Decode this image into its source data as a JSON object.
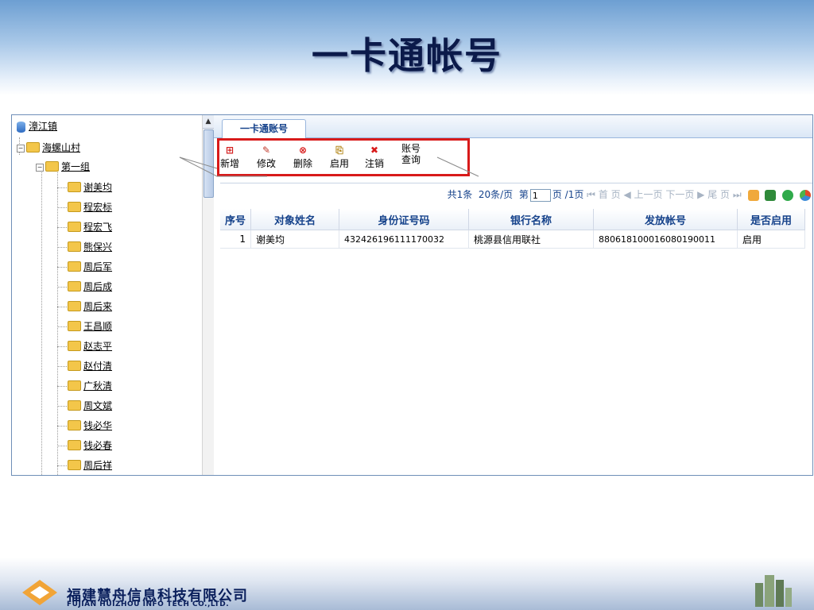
{
  "slide": {
    "title": "一卡通帐号"
  },
  "tree": {
    "root": "漳江镇",
    "village": "海螺山村",
    "group": "第一组",
    "people": [
      "谢美均",
      "程宏标",
      "程宏飞",
      "熊保兴",
      "周后军",
      "周后成",
      "周后来",
      "王昌顺",
      "赵志平",
      "赵付清",
      "广秋清",
      "周文斌",
      "钱必华",
      "钱必春",
      "周后祥"
    ]
  },
  "tab": {
    "label": "一卡通账号"
  },
  "toolbar": {
    "add": "新增",
    "edit": "修改",
    "delete": "删除",
    "enable": "启用",
    "cancel": "注销",
    "query_line1": "账号",
    "query_line2": "查询"
  },
  "pager": {
    "total": "共1条",
    "page_size": "20条/页",
    "page_prefix": "第",
    "page_value": "1",
    "page_suffix": "页 /1页",
    "first": "首 页",
    "prev": "上一页",
    "next": "下一页",
    "last": "尾 页"
  },
  "grid": {
    "headers": [
      "序号",
      "对象姓名",
      "身份证号码",
      "银行名称",
      "发放帐号",
      "是否启用"
    ],
    "rows": [
      {
        "no": "1",
        "name": "谢美均",
        "id_card": "432426196111170032",
        "bank": "桃源县信用联社",
        "account": "880618100016080190011",
        "enabled": "启用"
      }
    ]
  },
  "footer": {
    "company_cn": "福建慧舟信息科技有限公司",
    "company_en": "FUJIAN HUIZHOU INFO TECH CO.,LTD."
  },
  "colors": {
    "title": "#0b1a4a",
    "header_text": "#15428b",
    "highlight": "#d81a1a",
    "folder": "#f3c64a"
  },
  "icons": [
    "database-icon",
    "folder-icon",
    "add-icon",
    "edit-icon",
    "delete-icon",
    "enable-icon",
    "cancel-icon",
    "export-icon",
    "excel-icon",
    "refresh-icon",
    "chart-icon"
  ]
}
